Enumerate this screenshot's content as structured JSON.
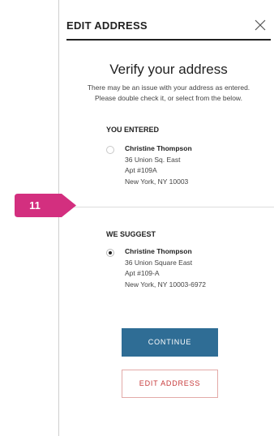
{
  "header": {
    "title": "EDIT ADDRESS",
    "close_icon": "close-icon"
  },
  "main": {
    "title": "Verify your address",
    "subtitle_line1": "There may be an issue with your address as entered.",
    "subtitle_line2": "Please double check it, or select from the below."
  },
  "entered": {
    "label": "YOU ENTERED",
    "selected": false,
    "name": "Christine Thompson",
    "line1": "36 Union Sq. East",
    "line2": "Apt #109A",
    "line3": "New York, NY 10003"
  },
  "suggested": {
    "label": "WE SUGGEST",
    "selected": true,
    "name": "Christine Thompson",
    "line1": "36 Union Square East",
    "line2": "Apt #109-A",
    "line3": "New York, NY 10003-6972"
  },
  "badge": {
    "text": "11",
    "color": "#d32f7f"
  },
  "buttons": {
    "continue_label": "CONTINUE",
    "edit_label": "EDIT ADDRESS"
  },
  "colors": {
    "primary": "#2f6d95",
    "secondary_text": "#c7393a"
  }
}
